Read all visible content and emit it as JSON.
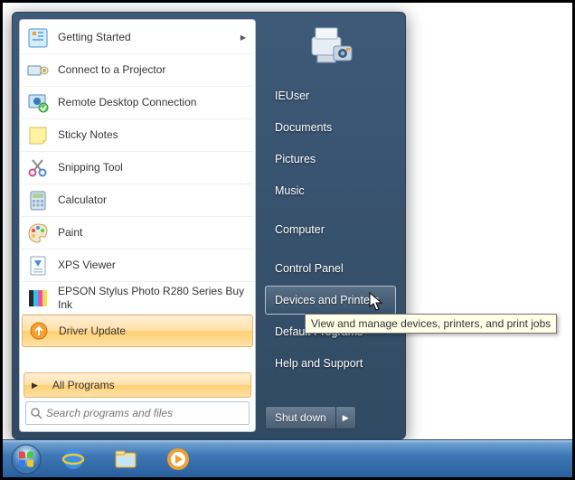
{
  "left": {
    "items": [
      {
        "label": "Getting Started",
        "hasArrow": true
      },
      {
        "label": "Connect to a Projector"
      },
      {
        "label": "Remote Desktop Connection"
      },
      {
        "label": "Sticky Notes"
      },
      {
        "label": "Snipping Tool"
      },
      {
        "label": "Calculator"
      },
      {
        "label": "Paint"
      },
      {
        "label": "XPS Viewer"
      },
      {
        "label": "EPSON Stylus Photo R280 Series Buy Ink"
      },
      {
        "label": "Driver Update"
      }
    ],
    "allPrograms": "All Programs",
    "searchPlaceholder": "Search programs and files"
  },
  "right": {
    "links": [
      "IEUser",
      "Documents",
      "Pictures",
      "Music",
      "Computer",
      "Control Panel",
      "Devices and Printers",
      "Default Programs",
      "Help and Support"
    ],
    "hoverIndex": 6,
    "shutdown": "Shut down"
  },
  "tooltip": "View and manage devices, printers, and print jobs"
}
